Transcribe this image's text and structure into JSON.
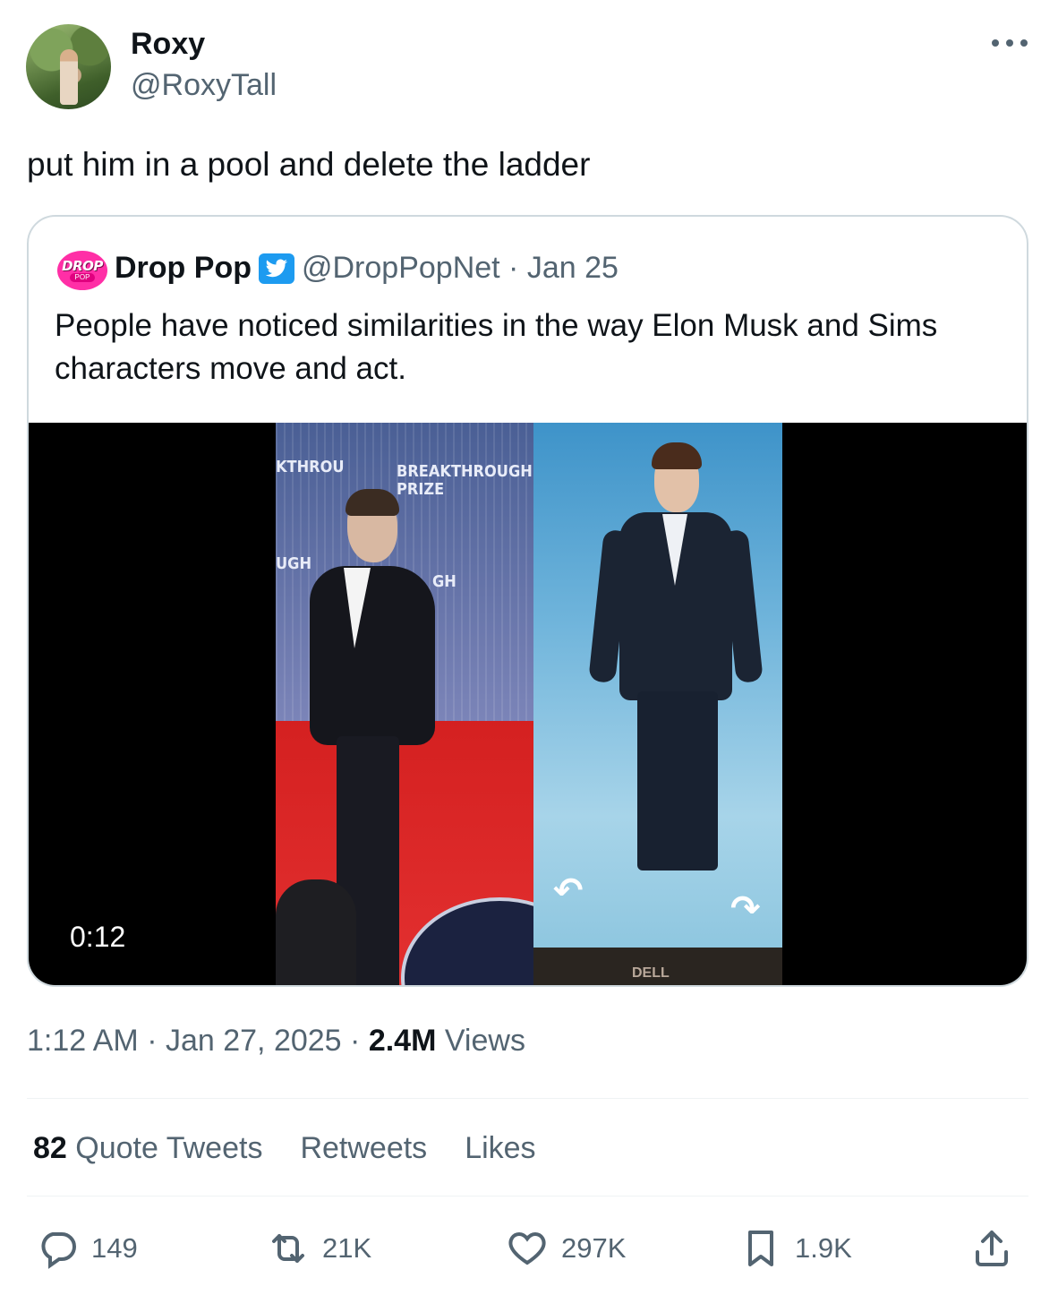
{
  "author": {
    "name": "Roxy",
    "handle": "@RoxyTall"
  },
  "tweet": {
    "text": "put him in a pool and delete the ladder"
  },
  "quote": {
    "avatar_text": "DROP",
    "avatar_subtext": "POP",
    "name": "Drop Pop",
    "handle": "@DropPopNet",
    "separator": " · ",
    "date": "Jan 25",
    "text": "People have noticed similarities in the way Elon Musk and Sims characters move and act.",
    "video": {
      "duration": "0:12",
      "backdrop_text_1": "BREAKTHROUGH",
      "backdrop_text_2": "PRIZE",
      "backdrop_text_3": "KTHROU",
      "backdrop_text_4": "UGH",
      "backdrop_text_5": "GH",
      "sim_brand": "DELL"
    }
  },
  "meta": {
    "time": "1:12 AM",
    "date": "Jan 27, 2025",
    "views_count": "2.4M",
    "views_label": "Views",
    "separator": " · "
  },
  "stats": {
    "quote_count": "82",
    "quote_label": "Quote Tweets",
    "retweets_label": "Retweets",
    "likes_label": "Likes"
  },
  "actions": {
    "replies": "149",
    "retweets": "21K",
    "likes": "297K",
    "bookmarks": "1.9K"
  },
  "colors": {
    "secondary_text": "#536471",
    "border": "#cfd9de",
    "verified": "#1d9bf0",
    "brand_pink": "#ff2fa6"
  }
}
